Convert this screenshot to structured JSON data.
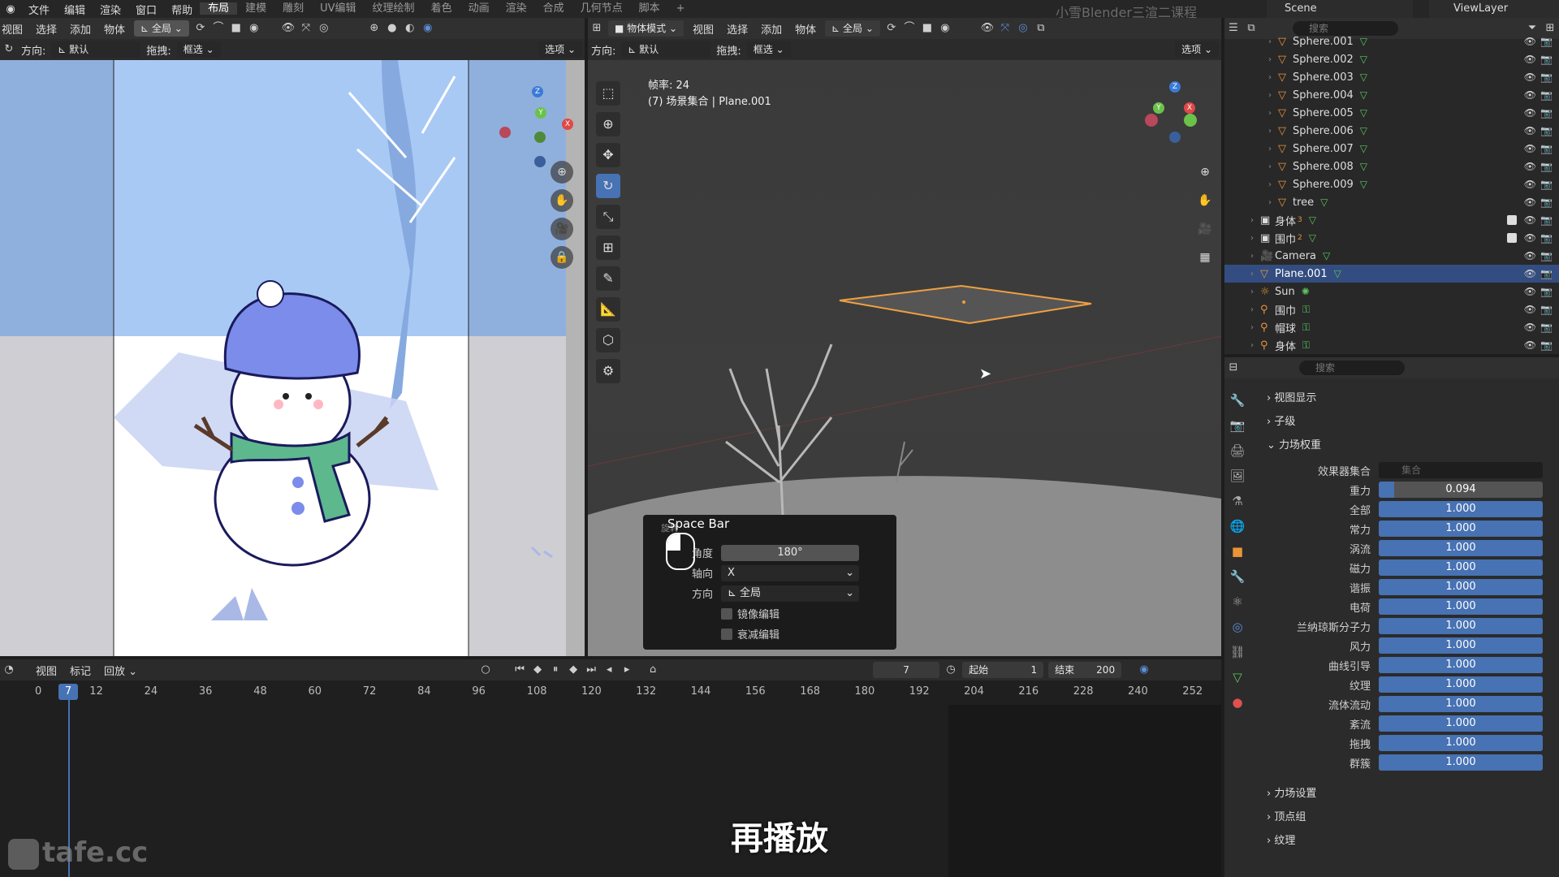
{
  "topbar": {
    "logo": "blender-logo",
    "menus": [
      "文件",
      "编辑",
      "渲染",
      "窗口",
      "帮助"
    ],
    "workspaces": [
      "布局",
      "建模",
      "雕刻",
      "UV编辑",
      "纹理绘制",
      "着色",
      "动画",
      "渲染",
      "合成",
      "几何节点",
      "脚本"
    ],
    "add": "+",
    "title": "小雪Blender三渲二课程",
    "scene": "Scene",
    "view_layer": "ViewLayer"
  },
  "left_viewport": {
    "menus": [
      "视图",
      "选择",
      "添加",
      "物体"
    ],
    "transform": "全局",
    "orientation_label": "方向:",
    "orientation_value": "默认",
    "drag_label": "拖拽:",
    "drag_value": "框选",
    "options": "选项"
  },
  "right_viewport": {
    "mode": "物体模式",
    "menus": [
      "视图",
      "选择",
      "添加",
      "物体"
    ],
    "transform": "全局",
    "orientation_label": "方向:",
    "orientation_value": "默认",
    "drag_label": "拖拽:",
    "drag_value": "框选",
    "options": "选项",
    "fps": "帧率: 24",
    "info": "(7) 场景集合 | Plane.001"
  },
  "popup": {
    "title": "Space Bar",
    "subtitle": "旋转",
    "angle_label": "角度",
    "angle_value": "180°",
    "axis_label": "轴向",
    "axis_value": "X",
    "orient_label": "方向",
    "orient_value": "全局",
    "mirror": "镜像编辑",
    "falloff": "衰减编辑"
  },
  "outliner": {
    "search_placeholder": "搜索",
    "rows": [
      {
        "name": "Sphere.001",
        "type": "mesh",
        "indent": 2
      },
      {
        "name": "Sphere.002",
        "type": "mesh",
        "indent": 2
      },
      {
        "name": "Sphere.003",
        "type": "mesh",
        "indent": 2
      },
      {
        "name": "Sphere.004",
        "type": "mesh",
        "indent": 2
      },
      {
        "name": "Sphere.005",
        "type": "mesh",
        "indent": 2
      },
      {
        "name": "Sphere.006",
        "type": "mesh",
        "indent": 2
      },
      {
        "name": "Sphere.007",
        "type": "mesh",
        "indent": 2
      },
      {
        "name": "Sphere.008",
        "type": "mesh",
        "indent": 2
      },
      {
        "name": "Sphere.009",
        "type": "mesh",
        "indent": 2
      },
      {
        "name": "tree",
        "type": "mesh",
        "indent": 2
      },
      {
        "name": "身体",
        "type": "collection",
        "indent": 1,
        "sub": "3"
      },
      {
        "name": "围巾",
        "type": "collection",
        "indent": 1,
        "sub": "2"
      },
      {
        "name": "Camera",
        "type": "camera",
        "indent": 1
      },
      {
        "name": "Plane.001",
        "type": "mesh",
        "indent": 1,
        "selected": true
      },
      {
        "name": "Sun",
        "type": "light",
        "indent": 1
      },
      {
        "name": "围巾",
        "type": "armature",
        "indent": 1
      },
      {
        "name": "帽球",
        "type": "armature",
        "indent": 1
      },
      {
        "name": "身体",
        "type": "armature",
        "indent": 1
      }
    ]
  },
  "properties": {
    "search_placeholder": "搜索",
    "sections_top": [
      "视图显示",
      "子级"
    ],
    "field_weights": "力场权重",
    "effector_label": "效果器集合",
    "effector_placeholder": "集合",
    "weights": [
      {
        "label": "重力",
        "value": "0.094",
        "fraction": 0.094
      },
      {
        "label": "全部",
        "value": "1.000",
        "fraction": 1
      },
      {
        "label": "常力",
        "value": "1.000",
        "fraction": 1
      },
      {
        "label": "涡流",
        "value": "1.000",
        "fraction": 1
      },
      {
        "label": "磁力",
        "value": "1.000",
        "fraction": 1
      },
      {
        "label": "谐振",
        "value": "1.000",
        "fraction": 1
      },
      {
        "label": "电荷",
        "value": "1.000",
        "fraction": 1
      },
      {
        "label": "兰纳琼斯分子力",
        "value": "1.000",
        "fraction": 1
      },
      {
        "label": "风力",
        "value": "1.000",
        "fraction": 1
      },
      {
        "label": "曲线引导",
        "value": "1.000",
        "fraction": 1
      },
      {
        "label": "纹理",
        "value": "1.000",
        "fraction": 1
      },
      {
        "label": "流体流动",
        "value": "1.000",
        "fraction": 1
      },
      {
        "label": "紊流",
        "value": "1.000",
        "fraction": 1
      },
      {
        "label": "拖拽",
        "value": "1.000",
        "fraction": 1
      },
      {
        "label": "群簇",
        "value": "1.000",
        "fraction": 1
      }
    ],
    "sections_bottom": [
      "力场设置",
      "顶点组",
      "纹理"
    ]
  },
  "timeline": {
    "menus": [
      "视图",
      "标记",
      "回放"
    ],
    "current_frame": "7",
    "start_label": "起始",
    "start": "1",
    "end_label": "结束",
    "end": "200",
    "ticks": [
      "0",
      "12",
      "24",
      "36",
      "48",
      "60",
      "72",
      "84",
      "96",
      "108",
      "120",
      "132",
      "144",
      "156",
      "168",
      "180",
      "192",
      "204",
      "216",
      "228",
      "240",
      "252"
    ],
    "playhead": "7"
  },
  "subtitle": "再播放",
  "watermark": "tafe.cc"
}
